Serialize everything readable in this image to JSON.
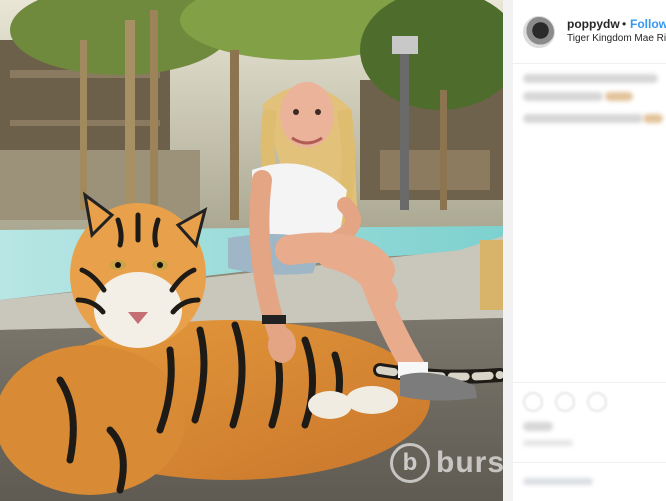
{
  "post": {
    "username": "poppydw",
    "separator": "•",
    "follow_label": "Follow",
    "location": "Tiger Kingdom Mae Ri",
    "avatar_icon": "user-avatar",
    "caption_blurred": true
  },
  "photo": {
    "subject": "photo",
    "watermark": "burs"
  },
  "colors": {
    "follow": "#3897f0",
    "text": "#262626",
    "divider": "#f2f2f2"
  }
}
